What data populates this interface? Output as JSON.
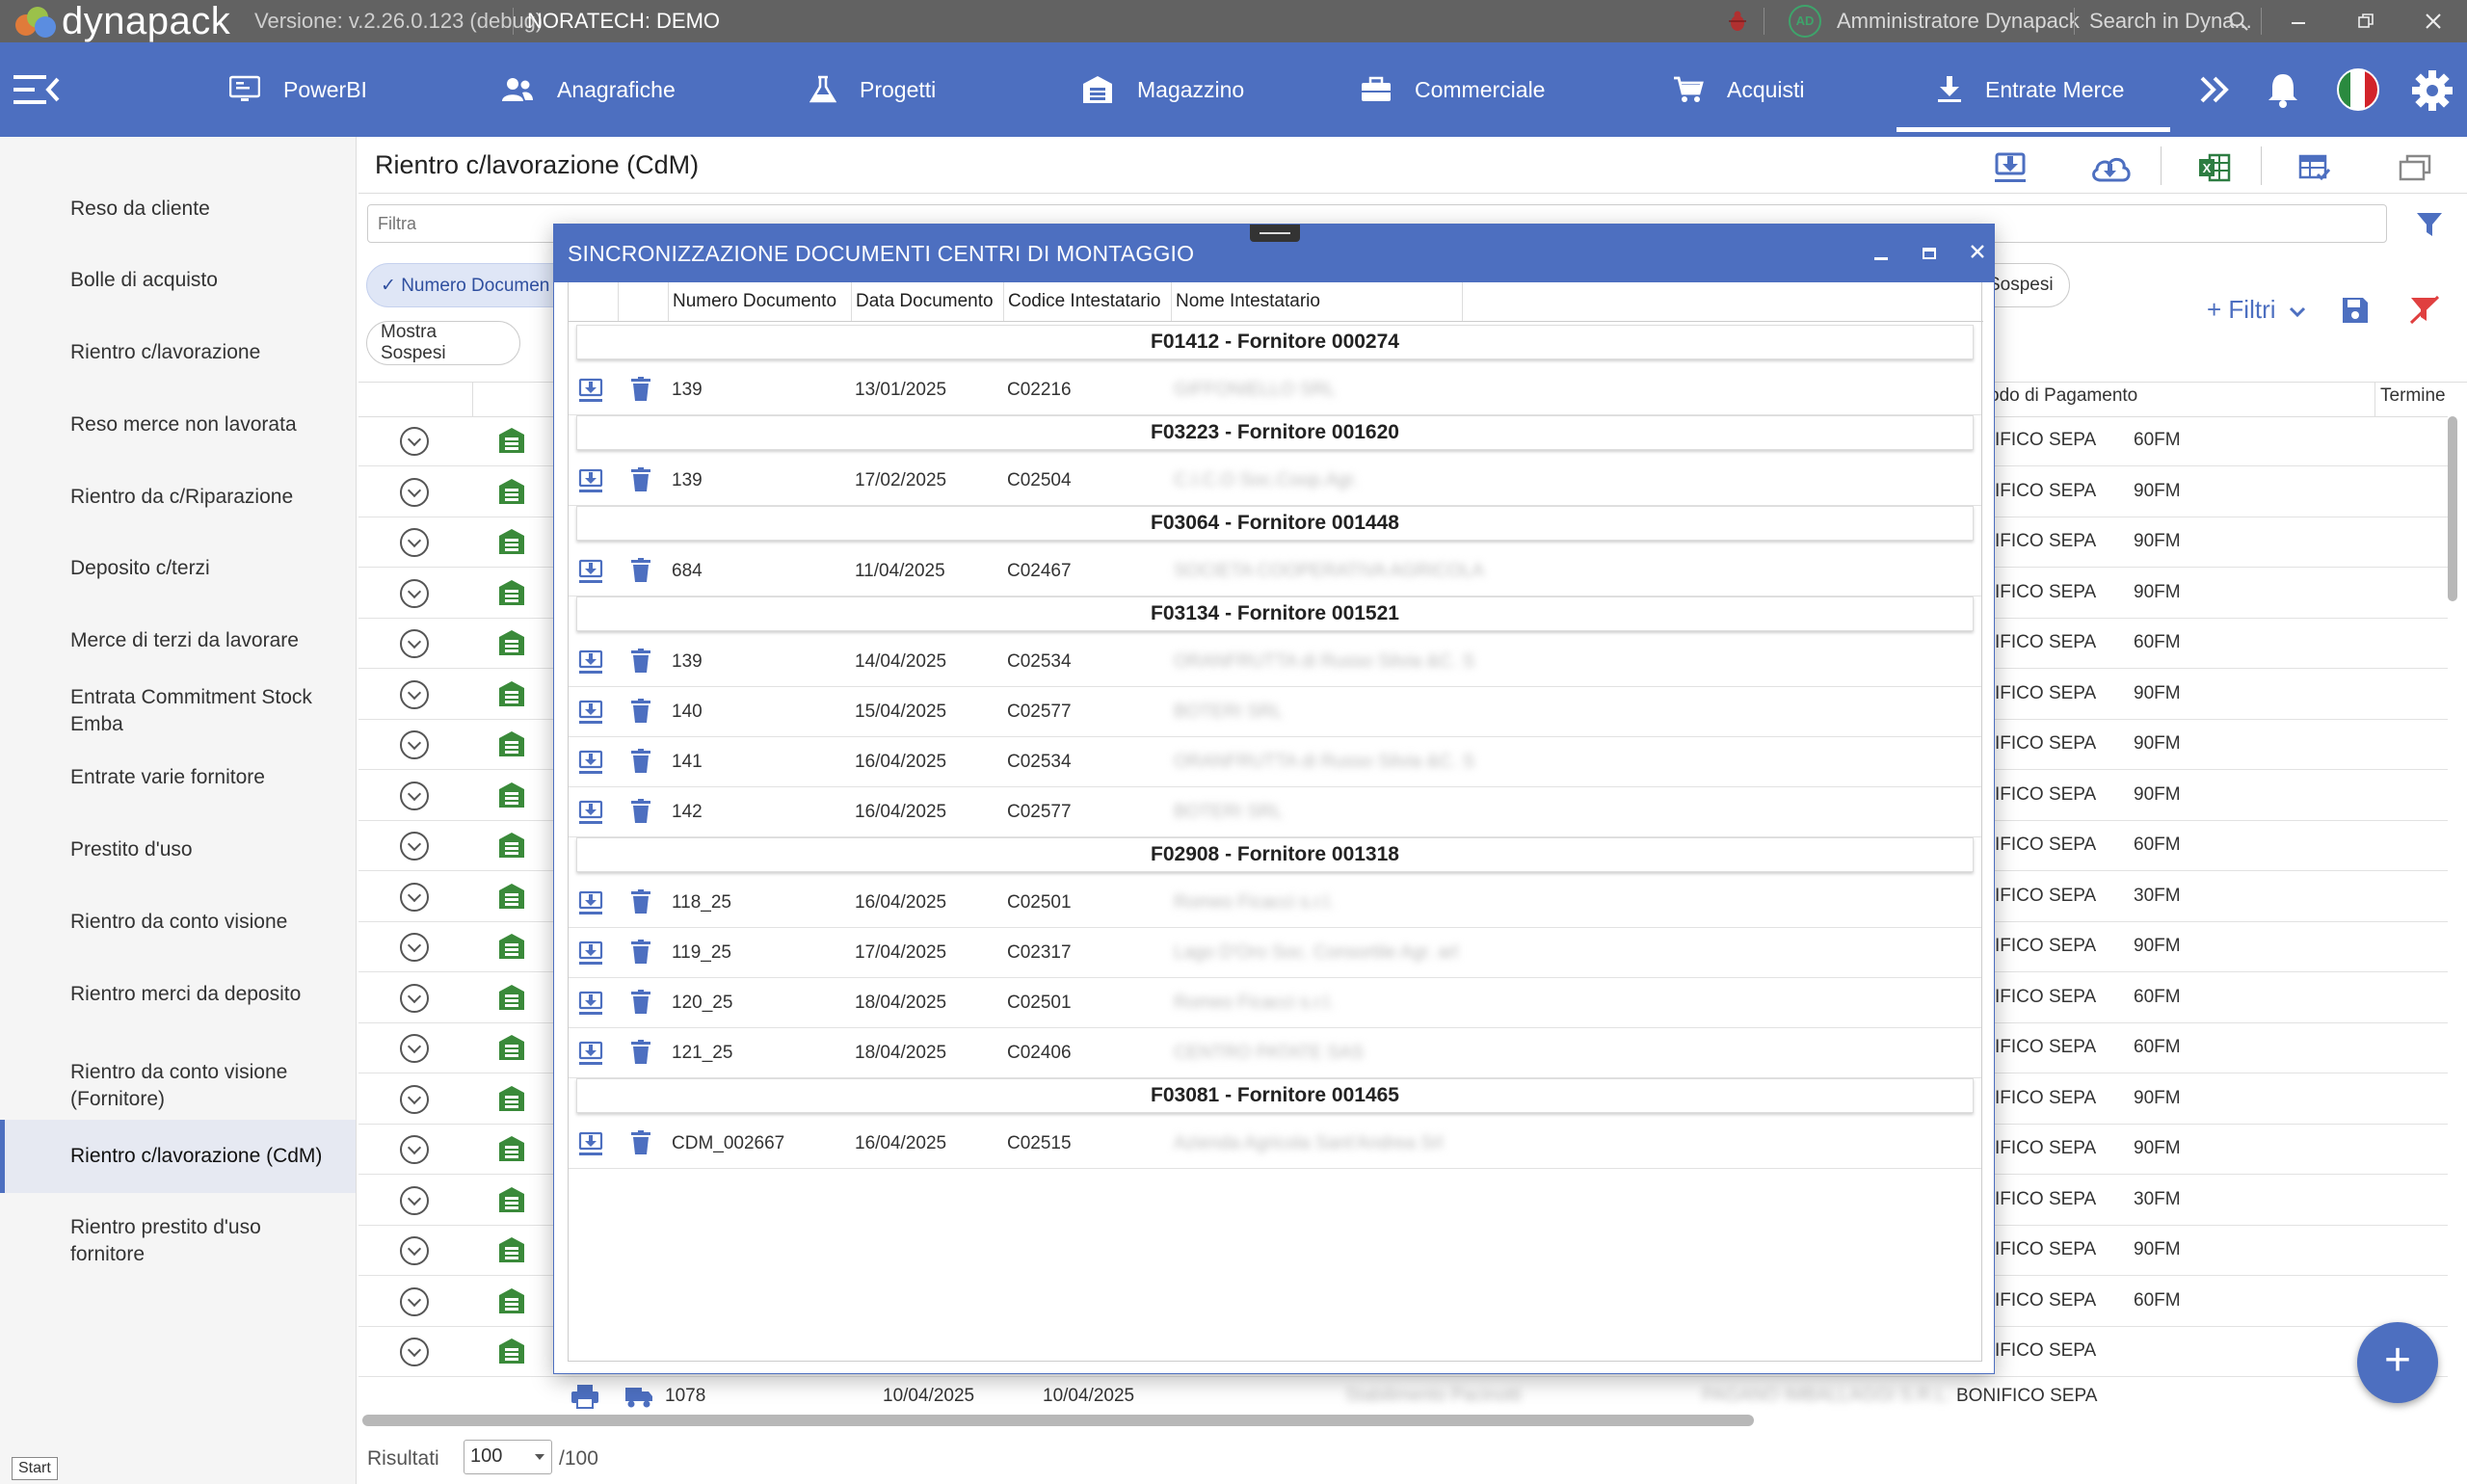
{
  "titlebar": {
    "app_name": "dynapack",
    "version": "Versione: v.2.26.0.123 (debug)",
    "company": "NORATECH: DEMO",
    "avatar_initials": "AD",
    "user": "Amministratore Dynapack",
    "search_placeholder": "Search in Dyna..."
  },
  "nav": {
    "items": [
      {
        "label": "PowerBI",
        "icon": "monitor-icon"
      },
      {
        "label": "Anagrafiche",
        "icon": "users-icon"
      },
      {
        "label": "Progetti",
        "icon": "flask-icon"
      },
      {
        "label": "Magazzino",
        "icon": "warehouse-icon"
      },
      {
        "label": "Commerciale",
        "icon": "briefcase-icon"
      },
      {
        "label": "Acquisti",
        "icon": "cart-icon"
      },
      {
        "label": "Entrate Merce",
        "icon": "download-icon"
      }
    ],
    "active": "Entrate Merce"
  },
  "sidebar": {
    "items": [
      {
        "label": "Reso da cliente"
      },
      {
        "label": "Bolle di acquisto"
      },
      {
        "label": "Rientro c/lavorazione"
      },
      {
        "label": "Reso merce non lavorata"
      },
      {
        "label": "Rientro da c/Riparazione"
      },
      {
        "label": "Deposito c/terzi"
      },
      {
        "label": "Merce di terzi da lavorare"
      },
      {
        "label": "Entrata Commitment Stock Emba"
      },
      {
        "label": "Entrate varie fornitore"
      },
      {
        "label": "Prestito d'uso"
      },
      {
        "label": "Rientro da conto visione"
      },
      {
        "label": "Rientro merci da deposito"
      },
      {
        "label": "Rientro da conto visione (Fornitore)"
      },
      {
        "label": "Rientro c/lavorazione (CdM)"
      },
      {
        "label": "Rientro prestito d'uso fornitore"
      }
    ],
    "active_index": 13,
    "start_label": "Start"
  },
  "content": {
    "title": "Rientro c/lavorazione (CdM)",
    "filter_placeholder": "Filtra",
    "chip_numero": "✓ Numero Documen",
    "chip_sospesi": "Sospesi",
    "chip_mostra_sospesi": "Mostra Sospesi",
    "filtri_label": "+ Filtri",
    "col_pagamento": "odo di Pagamento",
    "col_termine": "Termine",
    "rows": [
      {
        "pag": "IFICO SEPA",
        "term": "60FM"
      },
      {
        "pag": "IFICO SEPA",
        "term": "90FM"
      },
      {
        "pag": "IFICO SEPA",
        "term": "90FM"
      },
      {
        "pag": "IFICO SEPA",
        "term": "90FM"
      },
      {
        "pag": "IFICO SEPA",
        "term": "60FM"
      },
      {
        "pag": "IFICO SEPA",
        "term": "90FM"
      },
      {
        "pag": "IFICO SEPA",
        "term": "90FM"
      },
      {
        "pag": "IFICO SEPA",
        "term": "90FM"
      },
      {
        "pag": "IFICO SEPA",
        "term": "60FM"
      },
      {
        "pag": "IFICO SEPA",
        "term": "30FM"
      },
      {
        "pag": "IFICO SEPA",
        "term": "90FM"
      },
      {
        "pag": "IFICO SEPA",
        "term": "60FM"
      },
      {
        "pag": "IFICO SEPA",
        "term": "60FM"
      },
      {
        "pag": "IFICO SEPA",
        "term": "90FM"
      },
      {
        "pag": "IFICO SEPA",
        "term": "90FM"
      },
      {
        "pag": "IFICO SEPA",
        "term": "30FM"
      },
      {
        "pag": "IFICO SEPA",
        "term": "90FM"
      },
      {
        "pag": "IFICO SEPA",
        "term": "60FM"
      },
      {
        "pag": "IFICO SEPA",
        "term": ""
      }
    ],
    "last_row": {
      "num": "1078",
      "date1": "10/04/2025",
      "date2": "10/04/2025",
      "blur1": "Stabilimento Pacinotti",
      "blur2": "PAGANO IMBALLAGGI S.R.L.",
      "pag": "BONIFICO SEPA"
    },
    "results_label": "Risultati",
    "results_value": "100",
    "results_max": "/100"
  },
  "modal": {
    "title": "SINCRONIZZAZIONE DOCUMENTI CENTRI DI MONTAGGIO",
    "columns": [
      "Numero Documento",
      "Data Documento",
      "Codice Intestatario",
      "Nome Intestatario"
    ],
    "groups": [
      {
        "title": "F01412 - Fornitore 000274",
        "rows": [
          {
            "num": "139",
            "date": "13/01/2025",
            "code": "C02216",
            "name": "GIFFONIELLO SRL"
          }
        ]
      },
      {
        "title": "F03223 - Fornitore 001620",
        "rows": [
          {
            "num": "139",
            "date": "17/02/2025",
            "code": "C02504",
            "name": "C.I.C.O Soc.Coop.Agr."
          }
        ]
      },
      {
        "title": "F03064 - Fornitore 001448",
        "rows": [
          {
            "num": "684",
            "date": "11/04/2025",
            "code": "C02467",
            "name": "SOCIETA COOPERATIVA AGRICOLA"
          }
        ]
      },
      {
        "title": "F03134 - Fornitore 001521",
        "rows": [
          {
            "num": "139",
            "date": "14/04/2025",
            "code": "C02534",
            "name": "ORANFRUTTA di Russo Silvia &C. S"
          },
          {
            "num": "140",
            "date": "15/04/2025",
            "code": "C02577",
            "name": "BOTERI SRL"
          },
          {
            "num": "141",
            "date": "16/04/2025",
            "code": "C02534",
            "name": "ORANFRUTTA di Russo Silvia &C. S"
          },
          {
            "num": "142",
            "date": "16/04/2025",
            "code": "C02577",
            "name": "BOTERI SRL"
          }
        ]
      },
      {
        "title": "F02908 - Fornitore 001318",
        "rows": [
          {
            "num": "118_25",
            "date": "16/04/2025",
            "code": "C02501",
            "name": "Romeo Ficacci s.r.l."
          },
          {
            "num": "119_25",
            "date": "17/04/2025",
            "code": "C02317",
            "name": "Lago D'Oro Soc. Consortile Agr. arl"
          },
          {
            "num": "120_25",
            "date": "18/04/2025",
            "code": "C02501",
            "name": "Romeo Ficacci s.r.l."
          },
          {
            "num": "121_25",
            "date": "18/04/2025",
            "code": "C02406",
            "name": "CENTRO PATATE SAS"
          }
        ]
      },
      {
        "title": "F03081 - Fornitore 001465",
        "rows": [
          {
            "num": "CDM_002667",
            "date": "16/04/2025",
            "code": "C02515",
            "name": "Azienda Agricola Sant'Andrea Srl"
          }
        ]
      }
    ]
  },
  "colors": {
    "brand_blue": "#4d6fc0",
    "titlebar_gray": "#626262",
    "warehouse_green": "#3a8a3a"
  }
}
